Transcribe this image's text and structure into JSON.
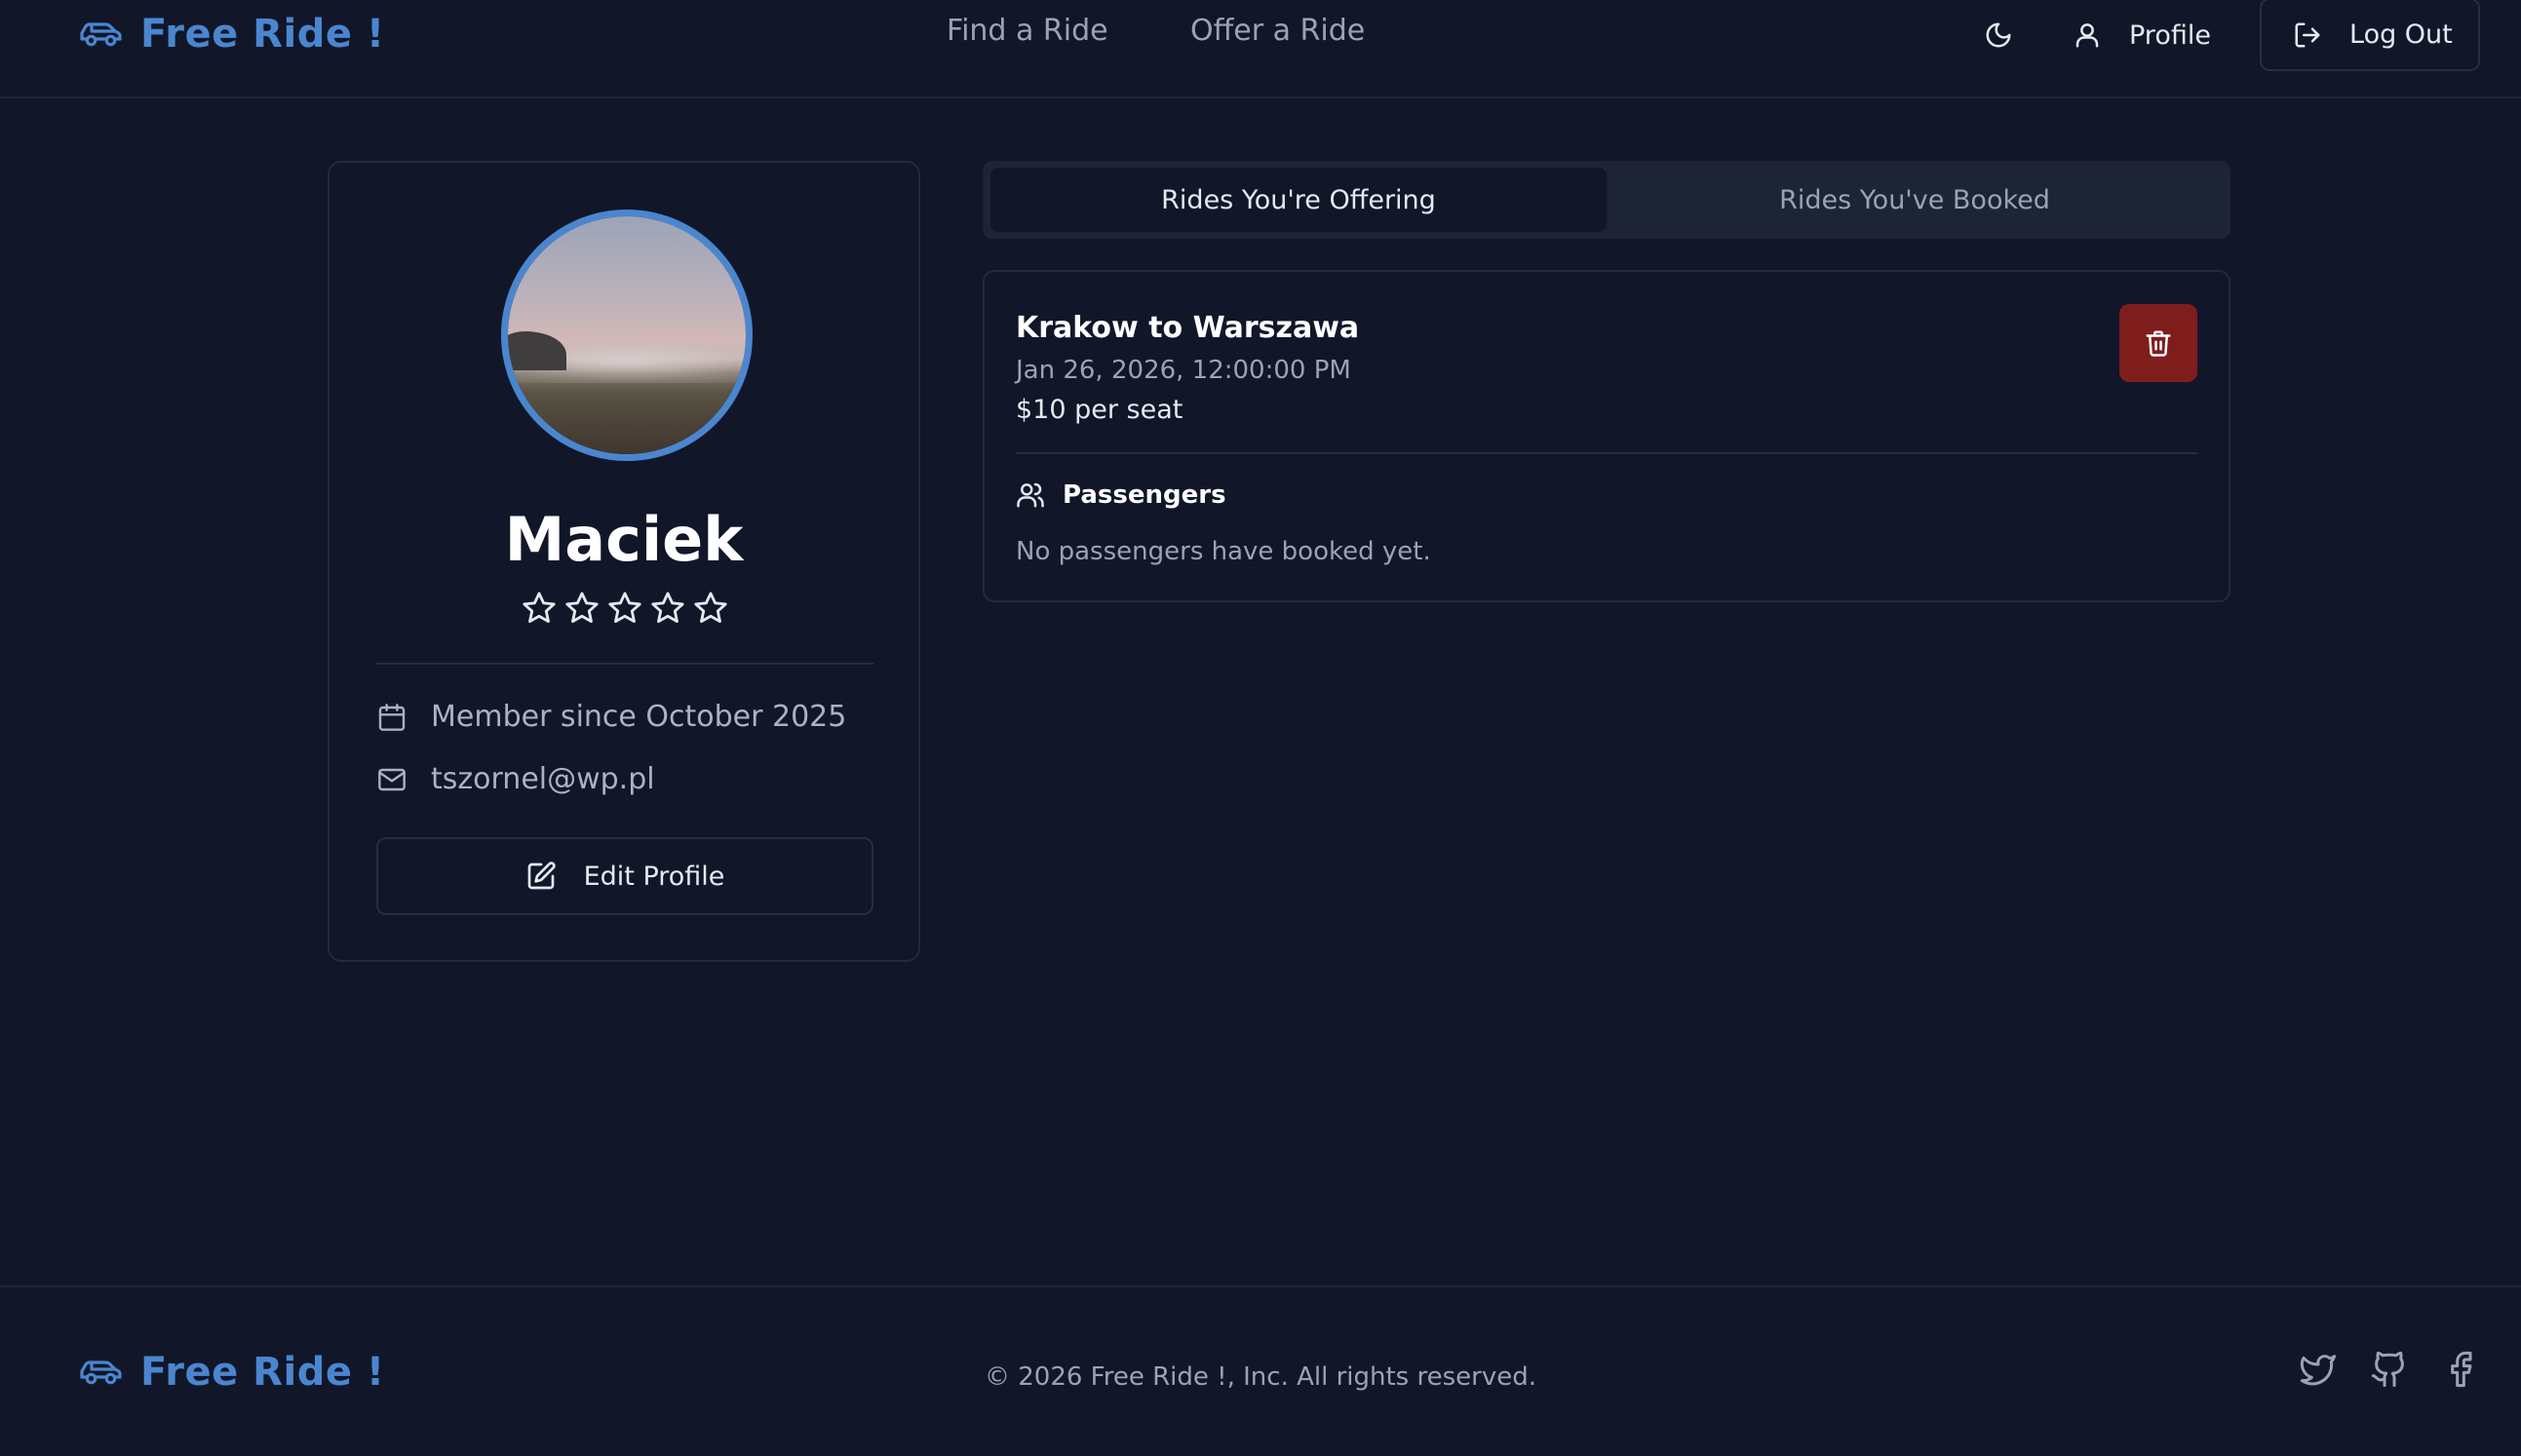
{
  "app": {
    "brand": "Free Ride !"
  },
  "header": {
    "nav": [
      "Find a Ride",
      "Offer a Ride"
    ],
    "profile_label": "Profile",
    "logout_label": "Log Out"
  },
  "profile": {
    "name": "Maciek",
    "rating": 0,
    "rating_max": 5,
    "member_since": "Member since October 2025",
    "email": "tszornel@wp.pl",
    "edit_label": "Edit Profile"
  },
  "tabs": [
    "Rides You're Offering",
    "Rides You've Booked"
  ],
  "ride": {
    "title": "Krakow to Warszawa",
    "datetime": "Jan 26, 2026, 12:00:00 PM",
    "price": "$10 per seat",
    "passengers_label": "Passengers",
    "passengers_empty": "No passengers have booked yet."
  },
  "footer": {
    "copyright": "© 2026 Free Ride !, Inc. All rights reserved."
  },
  "colors": {
    "background": "#111729",
    "accent": "#4a86cf",
    "danger": "#7f1d1d"
  },
  "icons": [
    "car-icon",
    "moon-icon",
    "user-icon",
    "logout-icon",
    "star-icon",
    "calendar-icon",
    "mail-icon",
    "edit-icon",
    "trash-icon",
    "users-icon",
    "twitter-icon",
    "github-icon",
    "facebook-icon"
  ]
}
